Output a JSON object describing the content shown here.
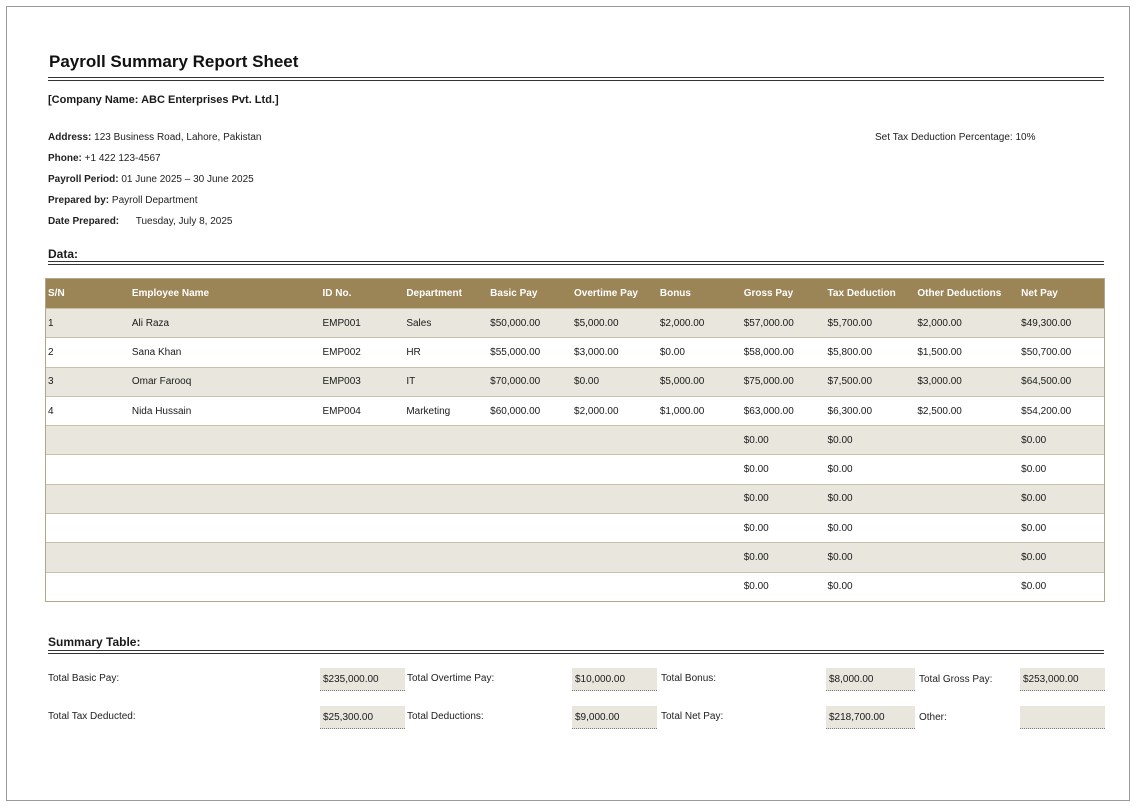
{
  "title": "Payroll Summary Report Sheet",
  "company": "[Company Name: ABC Enterprises Pvt. Ltd.]",
  "info": {
    "address_label": "Address:",
    "address": "123 Business Road, Lahore, Pakistan",
    "phone_label": "Phone:",
    "phone": "+1 422 123-4567",
    "period_label": "Payroll Period:",
    "period": "01 June 2025 – 30 June 2025",
    "prepared_by_label": "Prepared by:",
    "prepared_by": "Payroll Department",
    "date_label": "Date Prepared:",
    "date": "Tuesday, July 8, 2025"
  },
  "tax_setting": {
    "label": "Set Tax Deduction Percentage:",
    "value": "10%"
  },
  "data_label": "Data:",
  "table": {
    "headers": [
      "S/N",
      "Employee Name",
      "ID No.",
      "Department",
      "Basic Pay",
      "Overtime Pay",
      "Bonus",
      "Gross Pay",
      "Tax Deduction",
      "Other Deductions",
      "Net Pay"
    ],
    "rows": [
      [
        "1",
        "Ali Raza",
        "EMP001",
        "Sales",
        "$50,000.00",
        "$5,000.00",
        "$2,000.00",
        "$57,000.00",
        "$5,700.00",
        "$2,000.00",
        "$49,300.00"
      ],
      [
        "2",
        "Sana Khan",
        "EMP002",
        "HR",
        "$55,000.00",
        "$3,000.00",
        "$0.00",
        "$58,000.00",
        "$5,800.00",
        "$1,500.00",
        "$50,700.00"
      ],
      [
        "3",
        "Omar Farooq",
        "EMP003",
        "IT",
        "$70,000.00",
        "$0.00",
        "$5,000.00",
        "$75,000.00",
        "$7,500.00",
        "$3,000.00",
        "$64,500.00"
      ],
      [
        "4",
        "Nida Hussain",
        "EMP004",
        "Marketing",
        "$60,000.00",
        "$2,000.00",
        "$1,000.00",
        "$63,000.00",
        "$6,300.00",
        "$2,500.00",
        "$54,200.00"
      ],
      [
        "",
        "",
        "",
        "",
        "",
        "",
        "",
        "$0.00",
        "$0.00",
        "",
        "$0.00"
      ],
      [
        "",
        "",
        "",
        "",
        "",
        "",
        "",
        "$0.00",
        "$0.00",
        "",
        "$0.00"
      ],
      [
        "",
        "",
        "",
        "",
        "",
        "",
        "",
        "$0.00",
        "$0.00",
        "",
        "$0.00"
      ],
      [
        "",
        "",
        "",
        "",
        "",
        "",
        "",
        "$0.00",
        "$0.00",
        "",
        "$0.00"
      ],
      [
        "",
        "",
        "",
        "",
        "",
        "",
        "",
        "$0.00",
        "$0.00",
        "",
        "$0.00"
      ],
      [
        "",
        "",
        "",
        "",
        "",
        "",
        "",
        "$0.00",
        "$0.00",
        "",
        "$0.00"
      ]
    ]
  },
  "summary": {
    "label": "Summary Table:",
    "total_basic_label": "Total Basic Pay:",
    "total_basic": "$235,000.00",
    "total_overtime_label": "Total Overtime Pay:",
    "total_overtime": "$10,000.00",
    "total_bonus_label": "Total Bonus:",
    "total_bonus": "$8,000.00",
    "total_gross_label": "Total Gross Pay:",
    "total_gross": "$253,000.00",
    "total_tax_label": "Total Tax Deducted:",
    "total_tax": "$25,300.00",
    "total_deductions_label": "Total Deductions:",
    "total_deductions": "$9,000.00",
    "total_net_label": "Total Net Pay:",
    "total_net": "$218,700.00",
    "other_label": "Other:",
    "other": ""
  },
  "colors": {
    "header_bg": "#9b8455",
    "alt_row_bg": "#e9e6de"
  }
}
